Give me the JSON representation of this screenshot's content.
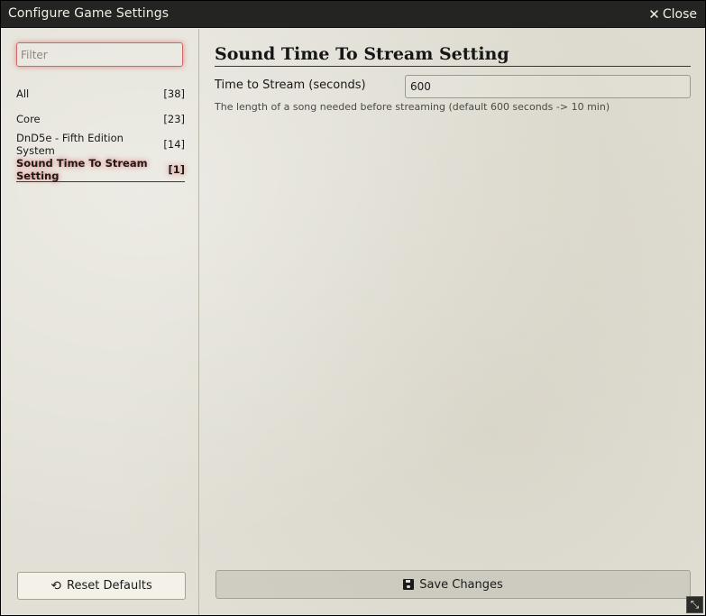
{
  "window": {
    "title": "Configure Game Settings",
    "close_label": "Close"
  },
  "sidebar": {
    "filter_placeholder": "Filter",
    "filter_value": "",
    "categories": [
      {
        "label": "All",
        "count": "[38]",
        "active": false
      },
      {
        "label": "Core",
        "count": "[23]",
        "active": false
      },
      {
        "label": "DnD5e - Fifth Edition System",
        "count": "[14]",
        "active": false
      },
      {
        "label": "Sound Time To Stream Setting",
        "count": "[1]",
        "active": true
      }
    ],
    "reset_label": "Reset Defaults"
  },
  "main": {
    "heading": "Sound Time To Stream Setting",
    "setting": {
      "label": "Time to Stream (seconds)",
      "value": "600",
      "hint": "The length of a song needed before streaming (default 600 seconds -> 10 min)"
    },
    "save_label": "Save Changes"
  },
  "icons": {
    "close": "close-icon",
    "reset": "undo-icon",
    "save": "floppy-disk-icon",
    "resize": "resize-icon"
  },
  "colors": {
    "titlebar_bg": "#242423",
    "panel_bg": "#e2e0d6",
    "accent_red": "#7a1a1a",
    "focus_glow": "#d06a6a"
  }
}
